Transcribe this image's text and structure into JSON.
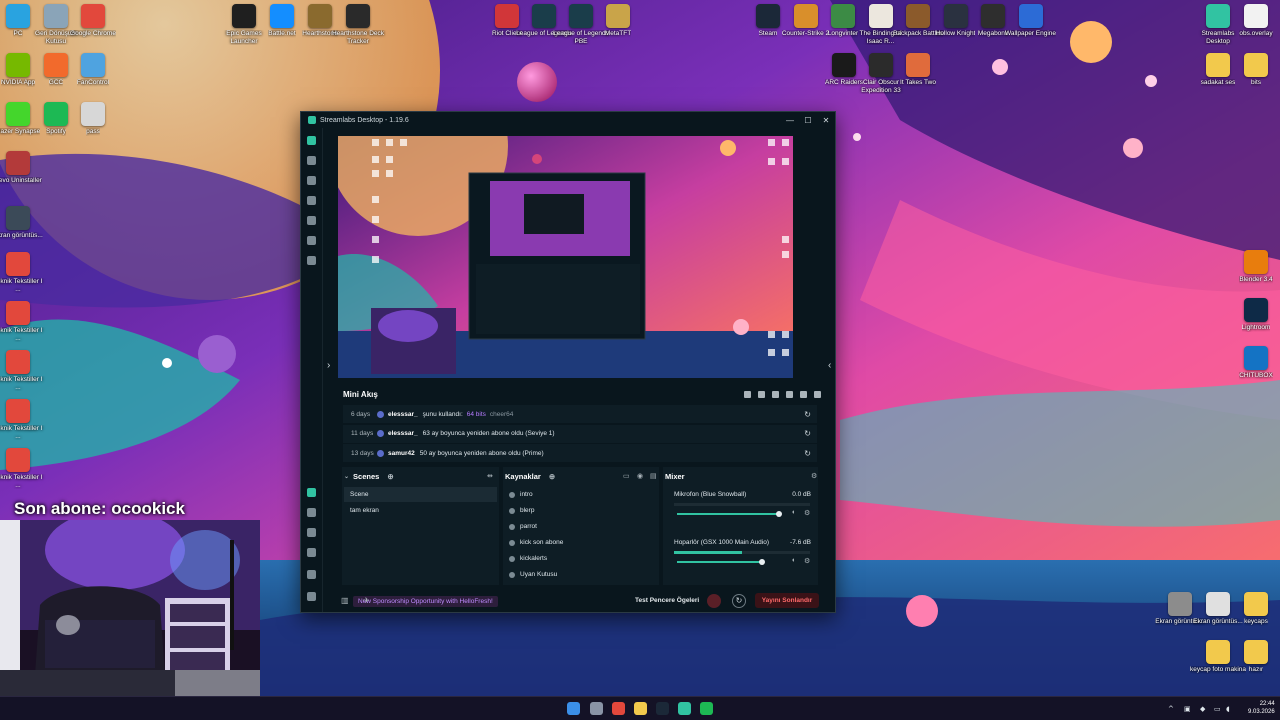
{
  "desktop": {
    "left_icons": [
      {
        "label": "PC",
        "color": "#29a3e0"
      },
      {
        "label": "Geri Dönüşüm Kutusu",
        "color": "#8aa4b8"
      },
      {
        "label": "Google Chrome",
        "color": "#e2483c"
      },
      {
        "label": "NVIDIA App",
        "color": "#76b900"
      },
      {
        "label": "GCC",
        "color": "#f26a2c"
      },
      {
        "label": "FanControl",
        "color": "#4fa3e0"
      },
      {
        "label": "Razer Synapse",
        "color": "#44d62c"
      },
      {
        "label": "Spotify",
        "color": "#1db954"
      },
      {
        "label": "pass",
        "color": "#d7d7d7"
      },
      {
        "label": "Revo Uninstaller",
        "color": "#b33a3a"
      },
      {
        "label": "Ekran görüntüs...",
        "color": "#3b4a58"
      },
      {
        "label": "Teknik Tekstiller I ...",
        "color": "#e2483c"
      },
      {
        "label": "Teknik Tekstiller I ...",
        "color": "#e2483c"
      },
      {
        "label": "Teknik Tekstiller I ...",
        "color": "#e2483c"
      },
      {
        "label": "Teknik Tekstiller I ...",
        "color": "#e2483c"
      },
      {
        "label": "Teknik Tekstiller I ...",
        "color": "#e2483c"
      }
    ],
    "top_icons_a": [
      {
        "label": "Epic Games Launcher",
        "color": "#1f1f1f"
      },
      {
        "label": "Battle.net",
        "color": "#148eff"
      },
      {
        "label": "Hearthstone",
        "color": "#8a6a2e"
      },
      {
        "label": "Hearthstone Deck Tracker",
        "color": "#2a2a2a"
      }
    ],
    "top_icons_b": [
      {
        "label": "Riot Client",
        "color": "#d13639"
      },
      {
        "label": "League of Legends",
        "color": "#1a3d4a"
      },
      {
        "label": "League of Legends PBE",
        "color": "#1a3d4a"
      },
      {
        "label": "MetaTFT",
        "color": "#c9a449"
      }
    ],
    "top_icons_c": [
      {
        "label": "Steam",
        "color": "#1b2838"
      },
      {
        "label": "Counter-Strike 2",
        "color": "#d98f2b"
      },
      {
        "label": "Longvinter",
        "color": "#3c8b45"
      },
      {
        "label": "The Binding of Isaac R...",
        "color": "#ece7de"
      },
      {
        "label": "Backpack Battles",
        "color": "#8b5a2b"
      },
      {
        "label": "Hollow Knight",
        "color": "#2a3140"
      },
      {
        "label": "Megabonk",
        "color": "#2e2e2e"
      },
      {
        "label": "Wallpaper Engine",
        "color": "#2c6bd6"
      }
    ],
    "top_icons_d": [
      {
        "label": "ARC Raiders",
        "color": "#1a1a1a"
      },
      {
        "label": "Clair Obscur Expedition 33",
        "color": "#2b2b2b"
      },
      {
        "label": "It Takes Two",
        "color": "#e06b3c"
      }
    ],
    "right_icons": [
      {
        "label": "Streamlabs Desktop",
        "color": "#31c3a2"
      },
      {
        "label": "obs.overlay",
        "color": "#f2f2f2"
      },
      {
        "label": "sadakat ses",
        "color": "#f2c94c"
      },
      {
        "label": "bits",
        "color": "#f2c94c"
      },
      {
        "label": "Blender 3.4",
        "color": "#e87d0d"
      },
      {
        "label": "Lightroom",
        "color": "#0e2a47"
      },
      {
        "label": "CHITUBOX",
        "color": "#1473c4"
      },
      {
        "label": "Ekran görüntüs...",
        "color": "#8c8c8c"
      },
      {
        "label": "Ekran görüntüs...",
        "color": "#e0e0e0"
      },
      {
        "label": "keycaps",
        "color": "#f2c94c"
      },
      {
        "label": "keycap foto makina",
        "color": "#f2c94c"
      },
      {
        "label": "hazır",
        "color": "#f2c94c"
      }
    ]
  },
  "overlay": {
    "title": "Son abone: ocookick"
  },
  "window": {
    "title": "Streamlabs Desktop - 1.19.6",
    "minimize": "—",
    "maximize": "☐",
    "close": "✕"
  },
  "mini_feed": {
    "title": "Mini Akış",
    "events": [
      {
        "age": "6 days",
        "user": "elesssar_",
        "message": "şunu kullandı:",
        "highlight": "64 bits",
        "extra": "cheer64"
      },
      {
        "age": "11 days",
        "user": "elesssar_",
        "message": "63 ay boyunca yeniden abone oldu (Seviye 1)",
        "highlight": "",
        "extra": ""
      },
      {
        "age": "13 days",
        "user": "samur42",
        "message": "50 ay boyunca yeniden abone oldu (Prime)",
        "highlight": "",
        "extra": ""
      }
    ]
  },
  "scenes": {
    "title": "Scenes",
    "items": [
      "Scene",
      "tam ekran"
    ]
  },
  "sources": {
    "title": "Kaynaklar",
    "items": [
      "intro",
      "blerp",
      "parrot",
      "kick son abone",
      "kickalerts",
      "Uyan Kutusu"
    ]
  },
  "mixer": {
    "title": "Mixer",
    "channels": [
      {
        "name": "Mikrofon (Blue Snowball)",
        "db": "0.0 dB",
        "level": 0.98,
        "meter": 0.0
      },
      {
        "name": "Hoparlör (GSX 1000 Main Audio)",
        "db": "-7.6 dB",
        "level": 0.82,
        "meter": 0.5
      }
    ]
  },
  "footer": {
    "sponsor": "New Sponsorship Opportunity with HelloFresh!",
    "test_label": "Test Pencere Ögeleri",
    "go_live": "Yayını Sonlandır"
  },
  "taskbar": {
    "time": "22:44",
    "date": "9.03.2026"
  }
}
